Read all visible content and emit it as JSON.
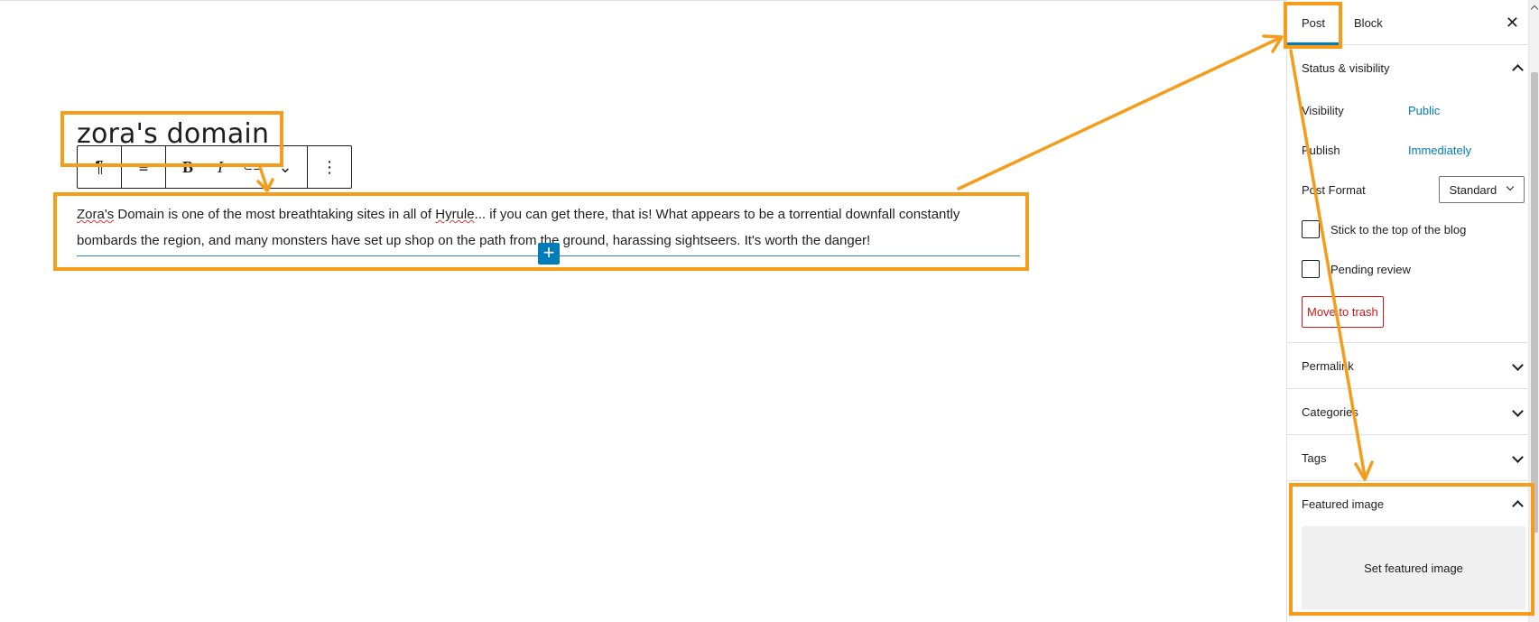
{
  "editor": {
    "post_title": "zora's domain",
    "paragraph": {
      "word1": "Zora's",
      "text1": " Domain is one of the most breathtaking sites in all of ",
      "word2": "Hyrule",
      "text2": "... if you can get there, that is! What appears to be a torrential downfall constantly bombards the region, and many monsters have set up shop on the path from the ground, harassing sightseers. It's worth the danger!"
    },
    "toolbar": {
      "paragraph_icon": "¶",
      "align_icon": "≡",
      "bold": "B",
      "italic": "I",
      "link_icon": "⊂⊃",
      "more_icon": "⌄",
      "options_icon": "⋮"
    },
    "inserter_icon": "+"
  },
  "sidebar": {
    "tabs": [
      {
        "label": "Post"
      },
      {
        "label": "Block"
      }
    ],
    "close_icon": "✕",
    "status_visibility": {
      "title": "Status & visibility",
      "visibility_label": "Visibility",
      "visibility_value": "Public",
      "publish_label": "Publish",
      "publish_value": "Immediately",
      "format_label": "Post Format",
      "format_value": "Standard",
      "stick_label": "Stick to the top of the blog",
      "pending_label": "Pending review",
      "trash_label": "Move to trash"
    },
    "panels": {
      "permalink": "Permalink",
      "categories": "Categories",
      "tags": "Tags",
      "featured_image": "Featured image"
    },
    "featured_image_button": "Set featured image"
  },
  "colors": {
    "annotation": "#f59c1a",
    "accent": "#007cba",
    "trash": "#cc1818"
  }
}
